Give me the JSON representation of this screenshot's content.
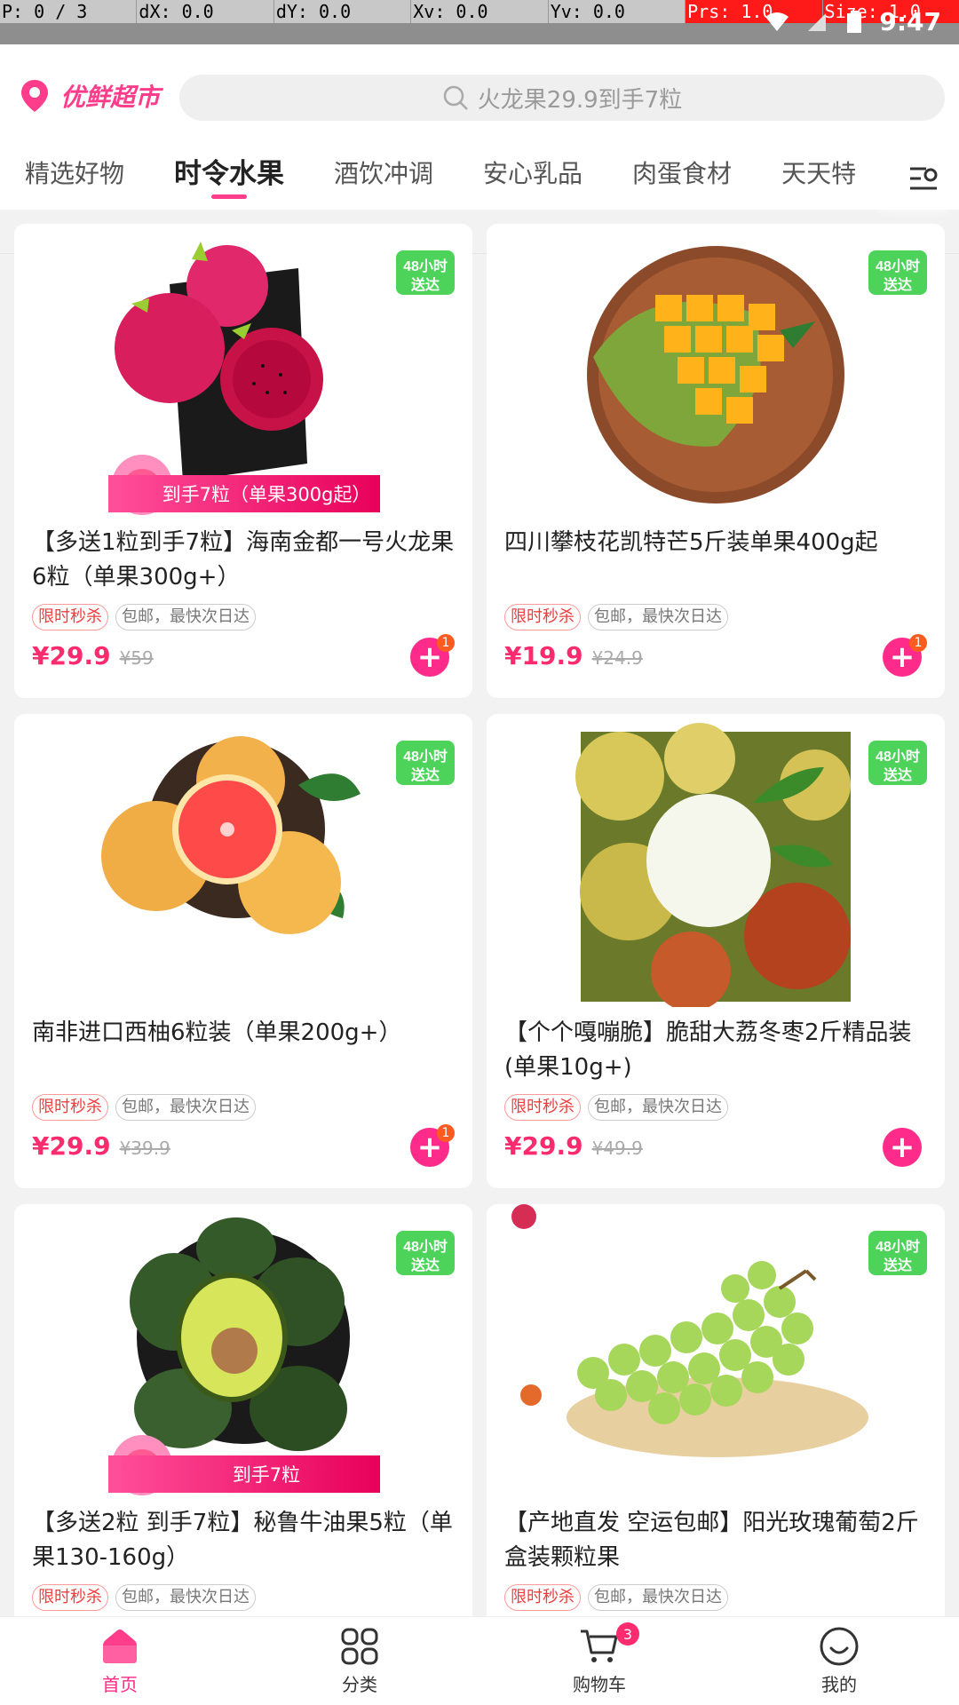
{
  "debug": {
    "pointer": "P: 0 / 3",
    "dx": "dX: 0.0",
    "dy": "dY: 0.0",
    "xv": "Xv: 0.0",
    "yv": "Yv: 0.0",
    "prs": "Prs: 1.0",
    "size": "Size: 1.0"
  },
  "status": {
    "time": "9:47"
  },
  "header": {
    "location": "优鲜超市",
    "search_placeholder": "火龙果29.9到手7粒"
  },
  "tabs": [
    {
      "label": "精选好物",
      "active": false
    },
    {
      "label": "时令水果",
      "active": true
    },
    {
      "label": "酒饮冲调",
      "active": false
    },
    {
      "label": "安心乳品",
      "active": false
    },
    {
      "label": "肉蛋食材",
      "active": false
    },
    {
      "label": "天天特",
      "active": false
    }
  ],
  "products": [
    {
      "title": "【多送1粒到手7粒】海南金都一号火龙果6粒（单果300g+）",
      "promo": "到手7粒（单果300g起）",
      "tag1": "限时秒杀",
      "tag2": "包邮，最快次日达",
      "price": "¥29.9",
      "old_price": "¥59",
      "badge": "1",
      "image": "dragonfruit"
    },
    {
      "title": "四川攀枝花凯特芒5斤装单果400g起",
      "promo": "",
      "tag1": "限时秒杀",
      "tag2": "包邮，最快次日达",
      "price": "¥19.9",
      "old_price": "¥24.9",
      "badge": "1",
      "image": "mango"
    },
    {
      "title": "南非进口西柚6粒装（单果200g+）",
      "promo": "",
      "tag1": "限时秒杀",
      "tag2": "包邮，最快次日达",
      "price": "¥29.9",
      "old_price": "¥39.9",
      "badge": "1",
      "image": "grapefruit"
    },
    {
      "title": "【个个嘎嘣脆】脆甜大荔冬枣2斤精品装 (单果10g+)",
      "promo": "",
      "tag1": "限时秒杀",
      "tag2": "包邮，最快次日达",
      "price": "¥29.9",
      "old_price": "¥49.9",
      "badge": "",
      "image": "jujube"
    },
    {
      "title": "【多送2粒 到手7粒】秘鲁牛油果5粒（单果130-160g）",
      "promo": "到手7粒",
      "tag1": "限时秒杀",
      "tag2": "包邮，最快次日达",
      "price": "",
      "old_price": "",
      "badge": "",
      "image": "avocado"
    },
    {
      "title": "【产地直发 空运包邮】阳光玫瑰葡萄2斤盒装颗粒果",
      "promo": "",
      "tag1": "限时秒杀",
      "tag2": "包邮，最快次日达",
      "price": "",
      "old_price": "",
      "badge": "",
      "image": "grapes"
    }
  ],
  "tabbar": [
    {
      "label": "首页",
      "icon": "home-icon",
      "active": true
    },
    {
      "label": "分类",
      "icon": "category-icon",
      "active": false
    },
    {
      "label": "购物车",
      "icon": "cart-icon",
      "active": false,
      "badge": "3"
    },
    {
      "label": "我的",
      "icon": "profile-icon",
      "active": false
    }
  ],
  "colors": {
    "accent": "#ff2b8a",
    "price": "#ff2b6e",
    "express_badge": "#39c24a"
  }
}
